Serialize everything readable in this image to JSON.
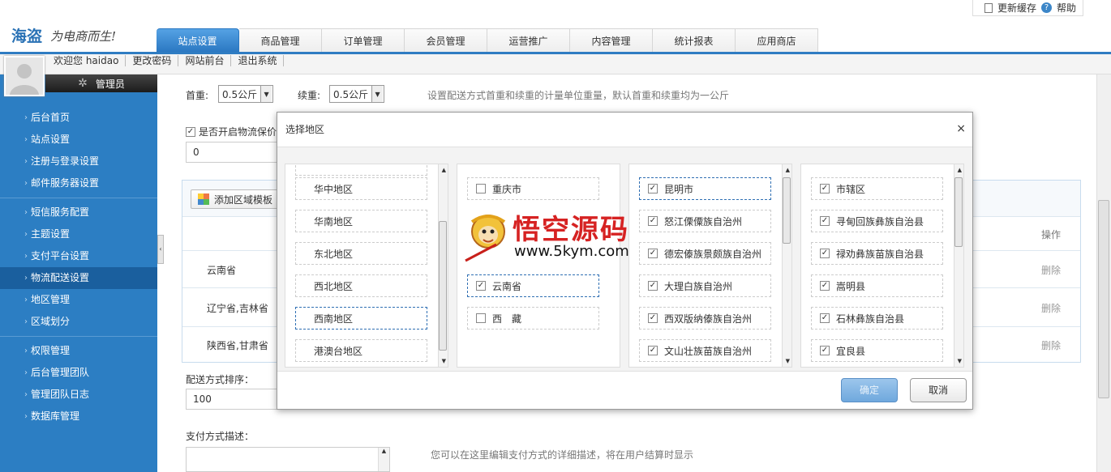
{
  "header": {
    "logo": "海盗",
    "slogan": "为电商而生!",
    "top_links": {
      "refresh_cache": "更新缓存",
      "help": "帮助"
    },
    "nav_tabs": [
      {
        "label": "站点设置",
        "active": true
      },
      {
        "label": "商品管理"
      },
      {
        "label": "订单管理"
      },
      {
        "label": "会员管理"
      },
      {
        "label": "运营推广"
      },
      {
        "label": "内容管理"
      },
      {
        "label": "统计报表"
      },
      {
        "label": "应用商店"
      }
    ],
    "welcome": "欢迎您 haidao",
    "sub_links": [
      "更改密码",
      "网站前台",
      "退出系统"
    ]
  },
  "sidebar": {
    "role": "管理员",
    "groups": [
      [
        "后台首页",
        "站点设置",
        "注册与登录设置",
        "邮件服务器设置"
      ],
      [
        "短信服务配置",
        "主题设置",
        "支付平台设置",
        "物流配送设置",
        "地区管理",
        "区域划分"
      ],
      [
        "权限管理",
        "后台管理团队",
        "管理团队日志",
        "数据库管理"
      ]
    ],
    "active_item": "物流配送设置"
  },
  "main": {
    "first_weight_label": "首重:",
    "first_weight_value": "0.5公斤",
    "add_weight_label": "续重:",
    "add_weight_value": "0.5公斤",
    "weight_hint": "设置配送方式首重和续重的计量单位重量，默认首重和续重均为一公斤",
    "insurance_label": "是否开启物流保价",
    "insurance_value": "0",
    "add_template_button": "添加区域模板",
    "operation_header": "操作",
    "rows": [
      {
        "region": "云南省",
        "action": "删除"
      },
      {
        "region": "辽宁省,吉林省",
        "action": "删除"
      },
      {
        "region": "陕西省,甘肃省",
        "action": "删除"
      }
    ],
    "sort_label": "配送方式排序：",
    "sort_value": "100",
    "pay_desc_label": "支付方式描述：",
    "pay_desc_hint": "您可以在这里编辑支付方式的详细描述，将在用户结算时显示"
  },
  "dialog": {
    "title": "选择地区",
    "close": "×",
    "col1": [
      "华中地区",
      "华南地区",
      "东北地区",
      "西北地区",
      "西南地区",
      "港澳台地区"
    ],
    "col1_selected": "西南地区",
    "col2": [
      {
        "label": "重庆市",
        "checked": false
      },
      {
        "label": "云南省",
        "checked": true
      },
      {
        "label": "西　藏",
        "checked": false
      }
    ],
    "col3": [
      {
        "label": "昆明市",
        "checked": true
      },
      {
        "label": "怒江傈僳族自治州",
        "checked": true
      },
      {
        "label": "德宏傣族景颇族自治州",
        "checked": true
      },
      {
        "label": "大理白族自治州",
        "checked": true
      },
      {
        "label": "西双版纳傣族自治州",
        "checked": true
      },
      {
        "label": "文山壮族苗族自治州",
        "checked": true
      }
    ],
    "col4": [
      {
        "label": "市辖区",
        "checked": true
      },
      {
        "label": "寻甸回族彝族自治县",
        "checked": true
      },
      {
        "label": "禄劝彝族苗族自治县",
        "checked": true
      },
      {
        "label": "嵩明县",
        "checked": true
      },
      {
        "label": "石林彝族自治县",
        "checked": true
      },
      {
        "label": "宜良县",
        "checked": true
      }
    ],
    "ok": "确定",
    "cancel": "取消"
  },
  "watermark": {
    "name": "悟空源码",
    "url": "www.5kym.com"
  },
  "colors": {
    "accent": "#2c7ec3",
    "brand_red": "#d62222"
  }
}
